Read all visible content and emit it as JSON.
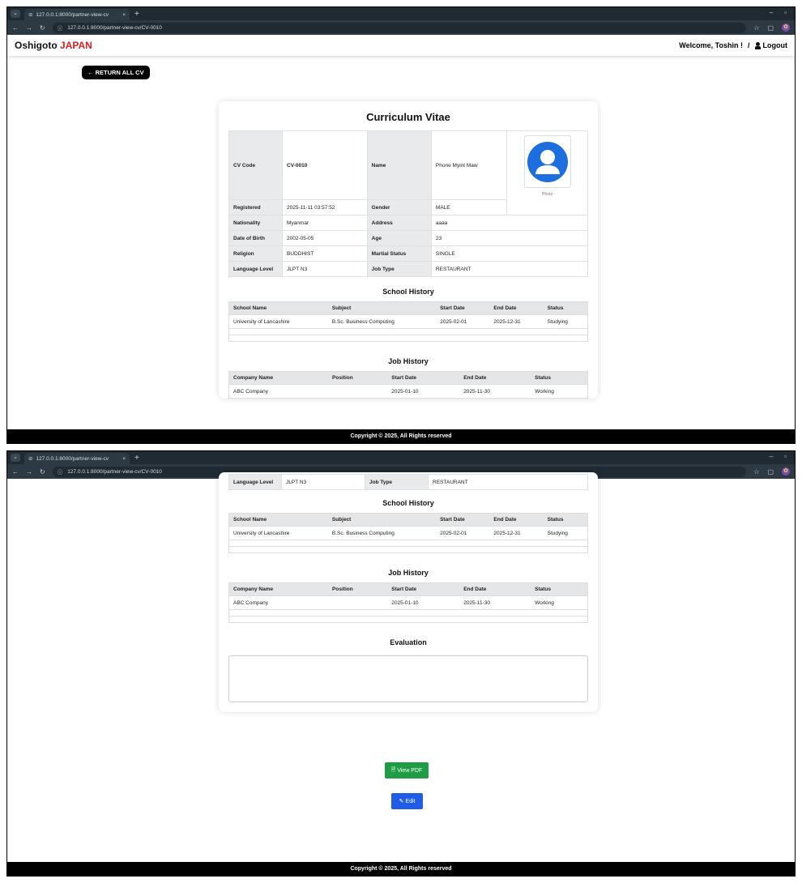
{
  "browser": {
    "tab_title": "127.0.0.1:8000/partner-view-cv",
    "url": "127.0.0.1:8000/partner-view-cv/CV-0010",
    "new_tab": "+",
    "tab_close": "×"
  },
  "nav": {
    "brand_main": "Oshigoto",
    "brand_accent": "JAPAN",
    "welcome": "Welcome, Toshin !",
    "separator": "/",
    "logout": "Logout"
  },
  "return_button": "← RETURN ALL CV",
  "cv": {
    "title": "Curriculum Vitae",
    "code_label": "CV Code",
    "code": "CV-0010",
    "name_label": "Name",
    "name": "Phone Myint Maw",
    "photo_label": "Photo",
    "registered_label": "Registered",
    "registered": "2025-11-11 03:57:52",
    "gender_label": "Gender",
    "gender": "MALE",
    "nationality_label": "Nationality",
    "nationality": "Myanmar",
    "address_label": "Address",
    "address": "aaaa",
    "dob_label": "Date of Birth",
    "dob": "2002-05-05",
    "age_label": "Age",
    "age": "23",
    "religion_label": "Religion",
    "religion": "BUDDHIST",
    "marital_label": "Martial Status",
    "marital": "SINGLE",
    "language_label": "Language Level",
    "language": "JLPT N3",
    "jobtype_label": "Job Type",
    "jobtype": "RESTAURANT"
  },
  "school": {
    "title": "School History",
    "headers": [
      "School Name",
      "Subject",
      "Start Date",
      "End Date",
      "Status"
    ],
    "rows": [
      [
        "University of Lancashire",
        "B.Sc. Business Computing",
        "2025-02-01",
        "2025-12-31",
        "Studying"
      ]
    ]
  },
  "job": {
    "title": "Job History",
    "headers": [
      "Company Name",
      "Position",
      "Start Date",
      "End Date",
      "Status"
    ],
    "rows": [
      [
        "ABC Company",
        "",
        "2025-01-10",
        "2025-11-30",
        "Working"
      ]
    ]
  },
  "evaluation": {
    "title": "Evaluation"
  },
  "buttons": {
    "pdf": "View PDF",
    "edit": "Edit"
  },
  "footer": "Copyright © 2025, All Rights reserved",
  "colors": {
    "accent": "#e02020",
    "pdf": "#1f9d45",
    "edit": "#1f5de8"
  }
}
